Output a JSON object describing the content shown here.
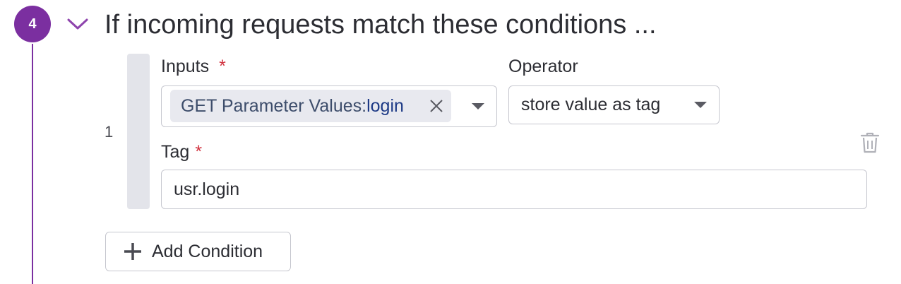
{
  "step": {
    "number": "4",
    "title": "If incoming requests match these conditions ...",
    "accent_color": "#7b2fa0"
  },
  "condition": {
    "index": "1",
    "inputs": {
      "label": "Inputs",
      "required_mark": "*",
      "chip_key": "GET Parameter Values:",
      "chip_value": "login"
    },
    "operator": {
      "label": "Operator",
      "value": "store value as tag"
    },
    "tag": {
      "label": "Tag",
      "required_mark": "*",
      "value": "usr.login"
    }
  },
  "add_condition": {
    "label": "Add Condition"
  },
  "icons": {
    "collapse": "chevron-down-icon",
    "chip_remove": "close-icon",
    "dropdown": "caret-down-icon",
    "delete": "trash-icon",
    "add": "plus-icon"
  }
}
